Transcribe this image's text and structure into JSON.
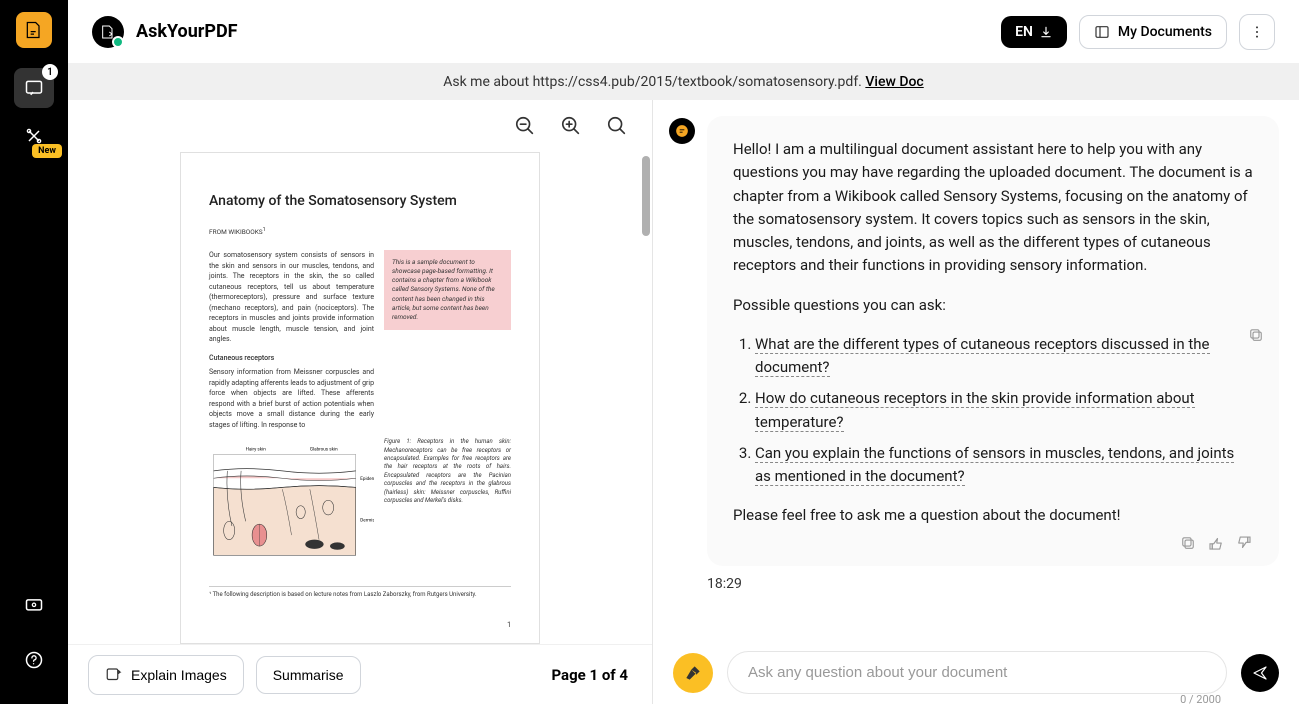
{
  "app": {
    "title": "AskYourPDF"
  },
  "sidebar": {
    "chat_badge": "1",
    "tools_badge": "New"
  },
  "header": {
    "lang": "EN",
    "docs": "My Documents"
  },
  "banner": {
    "prefix": "Ask me about https://css4.pub/2015/textbook/somatosensory.pdf. ",
    "link": "View Doc"
  },
  "pdf": {
    "title": "Anatomy of the Somatosensory System",
    "subtitle": "FROM WIKIBOOKS",
    "para1": "Our somatosensory system consists of sensors in the skin and sensors in our muscles, tendons, and joints. The receptors in the skin, the so called cutaneous receptors, tell us about temperature (thermoreceptors), pressure and surface texture (mechano receptors), and pain (nociceptors). The receptors in muscles and joints provide information about muscle length, muscle tension, and joint angles.",
    "note": "This is a sample document to showcase page-based formatting. It contains a chapter from a Wikibook called Sensory Systems. None of the content has been changed in this article, but some content has been removed.",
    "section": "Cutaneous receptors",
    "para2": "Sensory information from Meissner corpuscles and rapidly adapting afferents leads to adjustment of grip force when objects are lifted. These afferents respond with a brief burst of action potentials when objects move a small distance during the early stages of lifting. In response to",
    "figcap": "Figure 1: Receptors in the human skin: Mechanoreceptors can be free receptors or encapsulated. Examples for free receptors are the hair receptors at the roots of hairs. Encapsulated receptors are the Pacinian corpuscles and the receptors in the glabrous (hairless) skin: Meissner corpuscles, Ruffini corpuscles and Merkel's disks.",
    "footnote": "¹ The following description is based on lecture notes from Laszlo Zaborszky, from Rutgers University.",
    "pagenum": "1",
    "labels": {
      "hairy": "Hairy skin",
      "glab": "Glabrous skin",
      "epi": "Epidermis",
      "derm": "Dermis"
    }
  },
  "footer": {
    "explain": "Explain Images",
    "summarise": "Summarise",
    "page_ind": "Page 1 of 4"
  },
  "chat": {
    "greeting": "Hello! I am a multilingual document assistant here to help you with any questions you may have regarding the uploaded document. The document is a chapter from a Wikibook called Sensory Systems, focusing on the anatomy of the somatosensory system. It covers topics such as sensors in the skin, muscles, tendons, and joints, as well as the different types of cutaneous receptors and their functions in providing sensory information.",
    "prompt": "Possible questions you can ask:",
    "q1": "What are the different types of cutaneous receptors discussed in the document?",
    "q2": "How do cutaneous receptors in the skin provide information about temperature?",
    "q3": "Can you explain the functions of sensors in muscles, tendons, and joints as mentioned in the document?",
    "closer": "Please feel free to ask me a question about the document!",
    "time": "18:29",
    "placeholder": "Ask any question about your document",
    "counter": "0 / 2000"
  }
}
